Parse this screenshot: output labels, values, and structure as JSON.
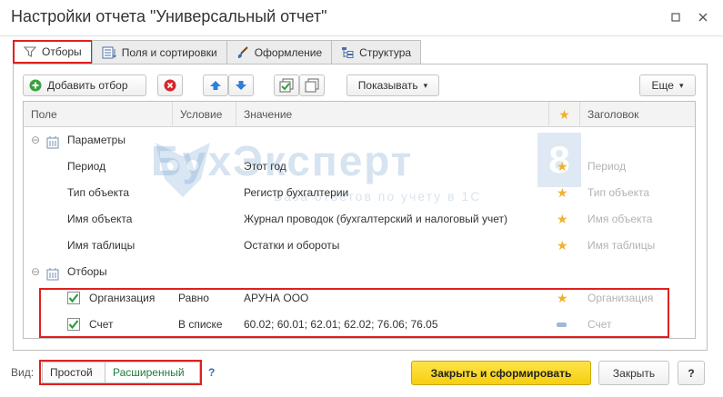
{
  "window": {
    "title": "Настройки отчета \"Универсальный отчет\""
  },
  "tabs": [
    {
      "label": "Отборы",
      "icon": "filter-icon",
      "active": true
    },
    {
      "label": "Поля и сортировки",
      "icon": "fields-icon"
    },
    {
      "label": "Оформление",
      "icon": "brush-icon"
    },
    {
      "label": "Структура",
      "icon": "structure-icon"
    }
  ],
  "toolbar": {
    "add_filter": "Добавить отбор",
    "show": "Показывать",
    "more": "Еще"
  },
  "grid": {
    "columns": [
      "Поле",
      "Условие",
      "Значение",
      "Заголовок"
    ],
    "groups": {
      "params": "Параметры",
      "filters": "Отборы"
    },
    "param_rows": [
      {
        "field": "Период",
        "value": "Этот год",
        "title": "Период"
      },
      {
        "field": "Тип объекта",
        "value": "Регистр бухгалтерии",
        "title": "Тип объекта"
      },
      {
        "field": "Имя объекта",
        "value": "Журнал проводок (бухгалтерский и налоговый учет)",
        "title": "Имя объекта"
      },
      {
        "field": "Имя таблицы",
        "value": "Остатки и обороты",
        "title": "Имя таблицы"
      }
    ],
    "filter_rows": [
      {
        "field": "Организация",
        "condition": "Равно",
        "value": "АРУНА ООО",
        "title": "Организация",
        "checked": true
      },
      {
        "field": "Счет",
        "condition": "В списке",
        "value": "60.02; 60.01; 62.01; 62.02; 76.06; 76.05",
        "title": "Счет",
        "checked": true
      }
    ]
  },
  "watermark": {
    "text": "БухЭксперт",
    "number": "8",
    "subtitle": "База ответов по учету в 1С"
  },
  "bottom": {
    "view_label": "Вид:",
    "simple": "Простой",
    "advanced": "Расширенный",
    "help": "?",
    "close_and_build": "Закрыть и сформировать",
    "close": "Закрыть",
    "question": "?"
  },
  "colors": {
    "accent_yellow": "#f5d31a",
    "red_highlight": "#e02020",
    "star": "#f0b030",
    "check_green": "#2e9e3e"
  }
}
